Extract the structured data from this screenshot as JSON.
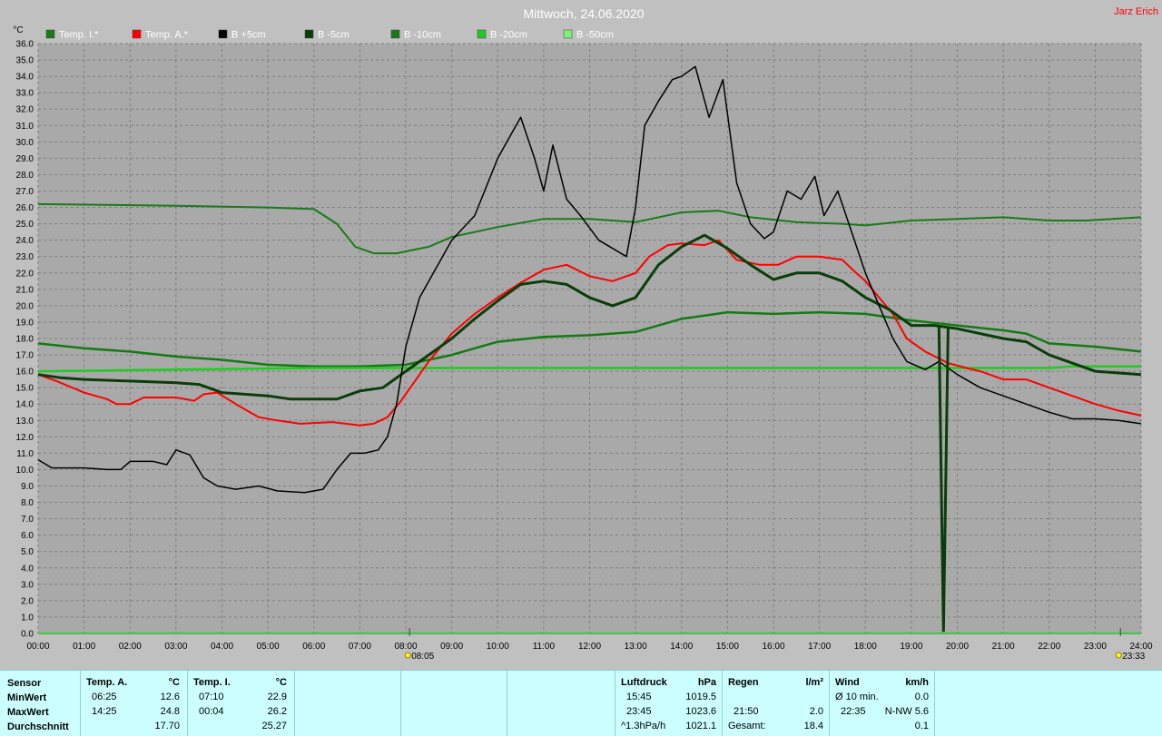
{
  "title": "Mittwoch, 24.06.2020",
  "author": "Jarz Erich",
  "y_unit": "°C",
  "colors": {
    "background": "#c0c0c0",
    "plot_bg": "#a9a9a9",
    "grid": "#7f7f7f",
    "temp_i": "#1a7a1a",
    "temp_a": "#ff0000",
    "b5": "#000000",
    "b_5": "#0b3d0b",
    "b_10": "#157a15",
    "b_20": "#1fcc1f",
    "b_50": "#7cf07c",
    "panel": "#ccffff"
  },
  "markers": [
    {
      "label": "08:05",
      "x": 8.083,
      "icon": "sunrise-icon"
    },
    {
      "label": "23:33",
      "x": 23.55,
      "icon": "sunset-icon"
    }
  ],
  "chart_data": {
    "type": "line",
    "title": "Mittwoch, 24.06.2020",
    "ylabel": "°C",
    "xlim": [
      0,
      24
    ],
    "ylim": [
      0,
      36
    ],
    "grid": true,
    "legend_placement": "top",
    "x_ticks": [
      "00:00",
      "01:00",
      "02:00",
      "03:00",
      "04:00",
      "05:00",
      "06:00",
      "07:00",
      "08:00",
      "09:00",
      "10:00",
      "11:00",
      "12:00",
      "13:00",
      "14:00",
      "15:00",
      "16:00",
      "17:00",
      "18:00",
      "19:00",
      "20:00",
      "21:00",
      "22:00",
      "23:00",
      "24:00"
    ],
    "y_ticks": [
      "0.0",
      "1.0",
      "2.0",
      "3.0",
      "4.0",
      "5.0",
      "6.0",
      "7.0",
      "8.0",
      "9.0",
      "10.0",
      "11.0",
      "12.0",
      "13.0",
      "14.0",
      "15.0",
      "16.0",
      "17.0",
      "18.0",
      "19.0",
      "20.0",
      "21.0",
      "22.0",
      "23.0",
      "24.0",
      "25.0",
      "26.0",
      "27.0",
      "28.0",
      "29.0",
      "30.0",
      "31.0",
      "32.0",
      "33.0",
      "34.0",
      "35.0",
      "36.0"
    ],
    "series": [
      {
        "name": "Temp. I.*",
        "color": "#1a7a1a",
        "width": 2,
        "points": [
          [
            0,
            26.2
          ],
          [
            3,
            26.1
          ],
          [
            5,
            26.0
          ],
          [
            6,
            25.9
          ],
          [
            6.5,
            25.0
          ],
          [
            6.9,
            23.6
          ],
          [
            7.3,
            23.2
          ],
          [
            7.8,
            23.2
          ],
          [
            8.5,
            23.6
          ],
          [
            9,
            24.2
          ],
          [
            10,
            24.8
          ],
          [
            11,
            25.3
          ],
          [
            12,
            25.3
          ],
          [
            13,
            25.1
          ],
          [
            14,
            25.7
          ],
          [
            14.8,
            25.8
          ],
          [
            15.5,
            25.4
          ],
          [
            16.5,
            25.1
          ],
          [
            17.5,
            25.0
          ],
          [
            18,
            24.9
          ],
          [
            19,
            25.2
          ],
          [
            20,
            25.3
          ],
          [
            21,
            25.4
          ],
          [
            22,
            25.2
          ],
          [
            22.8,
            25.2
          ],
          [
            24,
            25.4
          ]
        ]
      },
      {
        "name": "Temp. A.*",
        "color": "#ff0000",
        "width": 2,
        "points": [
          [
            0,
            15.8
          ],
          [
            0.4,
            15.4
          ],
          [
            1,
            14.7
          ],
          [
            1.5,
            14.3
          ],
          [
            1.7,
            14.0
          ],
          [
            2,
            14.0
          ],
          [
            2.3,
            14.4
          ],
          [
            3,
            14.4
          ],
          [
            3.4,
            14.2
          ],
          [
            3.6,
            14.6
          ],
          [
            3.9,
            14.7
          ],
          [
            4.3,
            14.0
          ],
          [
            4.8,
            13.2
          ],
          [
            5.2,
            13.0
          ],
          [
            5.7,
            12.8
          ],
          [
            6.4,
            12.9
          ],
          [
            7,
            12.7
          ],
          [
            7.3,
            12.8
          ],
          [
            7.6,
            13.2
          ],
          [
            7.9,
            14.2
          ],
          [
            8.2,
            15.4
          ],
          [
            8.5,
            16.6
          ],
          [
            9,
            18.3
          ],
          [
            9.5,
            19.5
          ],
          [
            10,
            20.5
          ],
          [
            10.5,
            21.4
          ],
          [
            11,
            22.2
          ],
          [
            11.5,
            22.5
          ],
          [
            12,
            21.8
          ],
          [
            12.5,
            21.5
          ],
          [
            13,
            22.0
          ],
          [
            13.3,
            23.0
          ],
          [
            13.7,
            23.7
          ],
          [
            14,
            23.8
          ],
          [
            14.5,
            23.7
          ],
          [
            14.8,
            24.0
          ],
          [
            15.2,
            22.8
          ],
          [
            15.7,
            22.5
          ],
          [
            16.1,
            22.5
          ],
          [
            16.5,
            23.0
          ],
          [
            17,
            23.0
          ],
          [
            17.5,
            22.8
          ],
          [
            17.8,
            22.0
          ],
          [
            18,
            21.5
          ],
          [
            18.3,
            20.5
          ],
          [
            18.6,
            19.5
          ],
          [
            18.9,
            18.0
          ],
          [
            19.3,
            17.2
          ],
          [
            19.8,
            16.5
          ],
          [
            20.2,
            16.2
          ],
          [
            20.5,
            16.0
          ],
          [
            21,
            15.5
          ],
          [
            21.5,
            15.5
          ],
          [
            22,
            15.0
          ],
          [
            22.5,
            14.5
          ],
          [
            23,
            14.0
          ],
          [
            23.5,
            13.6
          ],
          [
            24,
            13.3
          ]
        ]
      },
      {
        "name": "B +5cm",
        "color": "#000000",
        "width": 1.5,
        "points": [
          [
            0,
            10.6
          ],
          [
            0.3,
            10.1
          ],
          [
            1,
            10.1
          ],
          [
            1.5,
            10.0
          ],
          [
            1.8,
            10.0
          ],
          [
            2,
            10.5
          ],
          [
            2.5,
            10.5
          ],
          [
            2.8,
            10.3
          ],
          [
            3,
            11.2
          ],
          [
            3.3,
            10.9
          ],
          [
            3.6,
            9.5
          ],
          [
            3.9,
            9.0
          ],
          [
            4.3,
            8.8
          ],
          [
            4.8,
            9.0
          ],
          [
            5.2,
            8.7
          ],
          [
            5.8,
            8.6
          ],
          [
            6.2,
            8.8
          ],
          [
            6.5,
            10.0
          ],
          [
            6.8,
            11.0
          ],
          [
            7.1,
            11.0
          ],
          [
            7.4,
            11.2
          ],
          [
            7.6,
            12.0
          ],
          [
            7.8,
            14.0
          ],
          [
            8.0,
            17.5
          ],
          [
            8.3,
            20.5
          ],
          [
            8.6,
            22.0
          ],
          [
            9.0,
            24.0
          ],
          [
            9.5,
            25.5
          ],
          [
            10,
            29.0
          ],
          [
            10.3,
            30.5
          ],
          [
            10.5,
            31.5
          ],
          [
            10.8,
            29.0
          ],
          [
            11,
            27.0
          ],
          [
            11.2,
            29.8
          ],
          [
            11.5,
            26.5
          ],
          [
            11.8,
            25.5
          ],
          [
            12.2,
            24.0
          ],
          [
            12.5,
            23.5
          ],
          [
            12.8,
            23.0
          ],
          [
            13,
            26.0
          ],
          [
            13.2,
            31.0
          ],
          [
            13.5,
            32.5
          ],
          [
            13.8,
            33.8
          ],
          [
            14,
            34.0
          ],
          [
            14.3,
            34.6
          ],
          [
            14.6,
            31.5
          ],
          [
            14.9,
            33.8
          ],
          [
            15.2,
            27.5
          ],
          [
            15.5,
            25.0
          ],
          [
            15.8,
            24.1
          ],
          [
            16,
            24.5
          ],
          [
            16.3,
            27.0
          ],
          [
            16.6,
            26.5
          ],
          [
            16.9,
            27.9
          ],
          [
            17.1,
            25.5
          ],
          [
            17.4,
            27.0
          ],
          [
            17.7,
            24.5
          ],
          [
            18,
            22.0
          ],
          [
            18.3,
            20.0
          ],
          [
            18.6,
            18.0
          ],
          [
            18.9,
            16.6
          ],
          [
            19.3,
            16.1
          ],
          [
            19.6,
            16.6
          ],
          [
            20,
            15.8
          ],
          [
            20.5,
            15.0
          ],
          [
            21,
            14.5
          ],
          [
            21.5,
            14.0
          ],
          [
            22,
            13.5
          ],
          [
            22.5,
            13.1
          ],
          [
            23,
            13.1
          ],
          [
            23.5,
            13.0
          ],
          [
            24,
            12.8
          ]
        ]
      },
      {
        "name": "B -5cm",
        "color": "#0b3d0b",
        "width": 3,
        "points": [
          [
            0,
            15.8
          ],
          [
            0.5,
            15.6
          ],
          [
            1,
            15.5
          ],
          [
            2,
            15.4
          ],
          [
            3,
            15.3
          ],
          [
            3.5,
            15.2
          ],
          [
            4,
            14.7
          ],
          [
            5,
            14.5
          ],
          [
            5.5,
            14.3
          ],
          [
            6.5,
            14.3
          ],
          [
            7,
            14.8
          ],
          [
            7.5,
            15.0
          ],
          [
            8,
            16.0
          ],
          [
            8.5,
            17.0
          ],
          [
            9,
            18.0
          ],
          [
            9.5,
            19.2
          ],
          [
            10,
            20.3
          ],
          [
            10.5,
            21.3
          ],
          [
            11,
            21.5
          ],
          [
            11.5,
            21.3
          ],
          [
            12,
            20.5
          ],
          [
            12.5,
            20.0
          ],
          [
            13,
            20.5
          ],
          [
            13.5,
            22.5
          ],
          [
            14,
            23.6
          ],
          [
            14.5,
            24.3
          ],
          [
            15,
            23.5
          ],
          [
            15.5,
            22.5
          ],
          [
            16,
            21.6
          ],
          [
            16.5,
            22.0
          ],
          [
            17,
            22.0
          ],
          [
            17.5,
            21.5
          ],
          [
            18,
            20.5
          ],
          [
            18.5,
            19.8
          ],
          [
            19,
            18.8
          ],
          [
            19.5,
            18.8
          ],
          [
            20,
            18.6
          ],
          [
            20.5,
            18.3
          ],
          [
            21,
            18.0
          ],
          [
            21.5,
            17.8
          ],
          [
            22,
            17.0
          ],
          [
            22.5,
            16.5
          ],
          [
            23,
            16.0
          ],
          [
            24,
            15.8
          ]
        ]
      },
      {
        "name": "B -10cm",
        "color": "#157a15",
        "width": 2.5,
        "points": [
          [
            0,
            17.7
          ],
          [
            1,
            17.4
          ],
          [
            2,
            17.2
          ],
          [
            3,
            16.9
          ],
          [
            4,
            16.7
          ],
          [
            5,
            16.4
          ],
          [
            6,
            16.3
          ],
          [
            7,
            16.3
          ],
          [
            8,
            16.4
          ],
          [
            8.5,
            16.7
          ],
          [
            9,
            17.0
          ],
          [
            9.5,
            17.4
          ],
          [
            10,
            17.8
          ],
          [
            11,
            18.1
          ],
          [
            12,
            18.2
          ],
          [
            13,
            18.4
          ],
          [
            14,
            19.2
          ],
          [
            15,
            19.6
          ],
          [
            16,
            19.5
          ],
          [
            17,
            19.6
          ],
          [
            18,
            19.5
          ],
          [
            19,
            19.1
          ],
          [
            20,
            18.8
          ],
          [
            21,
            18.5
          ],
          [
            21.5,
            18.3
          ],
          [
            22,
            17.7
          ],
          [
            23,
            17.5
          ],
          [
            24,
            17.2
          ]
        ]
      },
      {
        "name": "B -20cm",
        "color": "#1fcc1f",
        "width": 2.5,
        "points": [
          [
            0,
            16.0
          ],
          [
            3,
            16.1
          ],
          [
            6,
            16.2
          ],
          [
            9,
            16.2
          ],
          [
            12,
            16.2
          ],
          [
            15,
            16.2
          ],
          [
            18,
            16.2
          ],
          [
            21,
            16.2
          ],
          [
            22,
            16.2
          ],
          [
            22.5,
            16.3
          ],
          [
            24,
            16.3
          ]
        ]
      },
      {
        "name": "B -50cm",
        "color": "#7cf07c",
        "width": 1.5,
        "points": []
      }
    ],
    "spikes": [
      {
        "name": "B -5cm",
        "color": "#0b3d0b",
        "points": [
          [
            19.6,
            18.8
          ],
          [
            19.7,
            0.1
          ],
          [
            19.8,
            18.7
          ]
        ]
      }
    ]
  },
  "panel": {
    "rows": [
      "Sensor",
      "MinWert",
      "MaxWert",
      "Durchschnitt"
    ],
    "temp_a": {
      "header": "Temp. A.",
      "unit": "°C",
      "min_time": "06:25",
      "min_val": "12.6",
      "max_time": "14:25",
      "max_val": "24.8",
      "avg": "17.70"
    },
    "temp_i": {
      "header": "Temp. I.",
      "unit": "°C",
      "min_time": "07:10",
      "min_val": "22.9",
      "max_time": "00:04",
      "max_val": "26.2",
      "avg": "25.27"
    },
    "pressure": {
      "header": "Luftdruck",
      "unit": "hPa",
      "r1_time": "15:45",
      "r1_val": "1019.5",
      "r2_time": "23:45",
      "r2_val": "1023.6",
      "r3_label": "^1.3hPa/h",
      "r3_val": "1021.1"
    },
    "rain": {
      "header": "Regen",
      "unit": "l/m²",
      "r2_time": "21:50",
      "r2_val": "2.0",
      "r3_label": "Gesamt:",
      "r3_val": "18.4"
    },
    "wind": {
      "header": "Wind",
      "unit": "km/h",
      "r1_label": "Ø 10 min.",
      "r1_val": "0.0",
      "r2_time": "22:35",
      "r2_val": "N-NW 5.6",
      "r3_val": "0.1"
    }
  }
}
